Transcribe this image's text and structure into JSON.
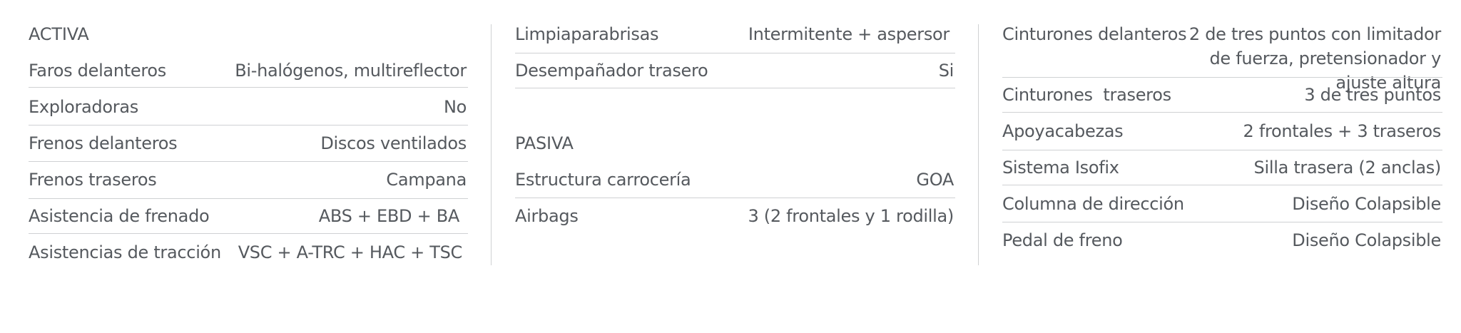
{
  "activa": {
    "heading": "ACTIVA",
    "rows": [
      {
        "label": "Faros delanteros",
        "value": "Bi-halógenos, multireflector"
      },
      {
        "label": "Exploradoras",
        "value": "No"
      },
      {
        "label": "Frenos delanteros",
        "value": "Discos ventilados"
      },
      {
        "label": "Frenos traseros",
        "value": "Campana"
      },
      {
        "label": "Asistencia de frenado",
        "value": "ABS + EBD + BA"
      },
      {
        "label": "Asistencias de tracción",
        "value": "VSC + A-TRC + HAC + TSC"
      }
    ]
  },
  "column2": {
    "rows": [
      {
        "label": "Limpiaparabrisas",
        "value": "Intermitente + aspersor"
      },
      {
        "label": "Desempañador trasero",
        "value": "Si"
      }
    ]
  },
  "pasiva": {
    "heading": "PASIVA",
    "rows": [
      {
        "label": "Estructura carrocería",
        "value": "GOA"
      },
      {
        "label": "Airbags",
        "value": "3 (2 frontales y 1 rodilla)"
      }
    ]
  },
  "column3": {
    "rows": [
      {
        "label": "Cinturones delanteros",
        "value": "2 de tres puntos con limitador de fuerza, pretensionador y ajuste altura"
      },
      {
        "label": "Cinturones  traseros",
        "value": "3 de tres puntos"
      },
      {
        "label": "Apoyacabezas",
        "value": "2 frontales + 3 traseros"
      },
      {
        "label": "Sistema Isofix",
        "value": "Silla trasera (2 anclas)"
      },
      {
        "label": "Columna de dirección",
        "value": "Diseño Colapsible"
      },
      {
        "label": "Pedal de freno",
        "value": "Diseño Colapsible"
      }
    ]
  }
}
